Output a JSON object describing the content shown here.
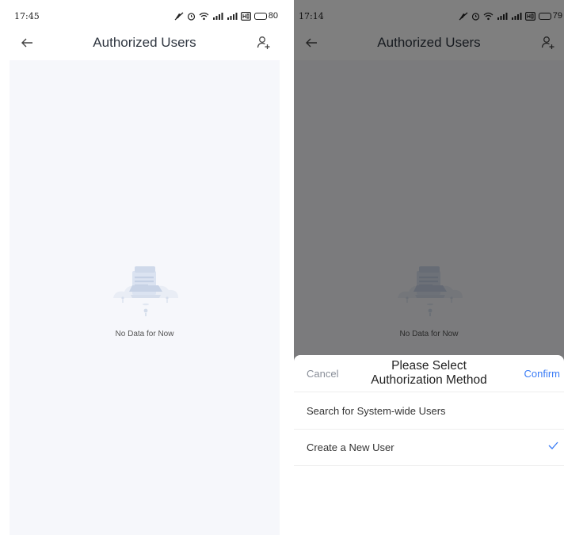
{
  "colors": {
    "accent": "#3a7cf6",
    "background": "#f6f7fb",
    "overlay": "rgba(0,0,0,0.5)"
  },
  "left_screen": {
    "status_bar": {
      "time": "17:45",
      "battery": "80",
      "battery_level": 0.8
    },
    "nav": {
      "title": "Authorized Users",
      "back_icon": "arrow-left-icon",
      "add_icon": "add-user-icon"
    },
    "empty_state": {
      "illustration": "empty-data-illustration",
      "text": "No Data for Now"
    }
  },
  "right_screen": {
    "status_bar": {
      "time": "17:14",
      "battery": "79",
      "battery_level": 0.79
    },
    "nav": {
      "title": "Authorized Users",
      "back_icon": "arrow-left-icon",
      "add_icon": "add-user-icon"
    },
    "empty_state": {
      "illustration": "empty-data-illustration",
      "text": "No Data for Now"
    },
    "sheet": {
      "cancel": "Cancel",
      "title": "Please Select Authorization Method",
      "confirm": "Confirm",
      "options": [
        {
          "label": "Search for System-wide Users",
          "selected": false
        },
        {
          "label": "Create a New User",
          "selected": true
        }
      ]
    }
  }
}
